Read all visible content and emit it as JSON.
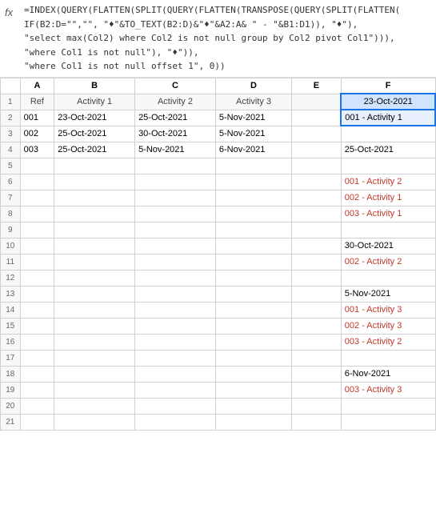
{
  "formula": {
    "fx_label": "fx",
    "text_lines": [
      "=INDEX(QUERY(FLATTEN(SPLIT(QUERY(FLATTEN(TRANSPOSE(QUERY(SPLIT(FLATTEN(",
      "IF(B2:D=\"\",\"\", \"♦\"&TO_TEXT(B2:D)&\"♦\"&A2:A& \" - \"&B1:D1)), \"♦\"),",
      "\"select max(Col2) where Col2 is not null group by Col2 pivot Col1\"))),",
      "\"where Col1 is not null\"), \"♦\")),",
      "\"where Col1 is not null offset 1\", 0))"
    ]
  },
  "columns": {
    "headers": [
      "",
      "A",
      "B",
      "C",
      "D",
      "E",
      "F"
    ]
  },
  "column_labels": {
    "A": "Ref",
    "B": "Activity 1",
    "C": "Activity 2",
    "D": "Activity 3",
    "E": "",
    "F": "23-Oct-2021"
  },
  "rows": [
    {
      "num": "1",
      "A": "Ref",
      "B": "Activity 1",
      "C": "Activity 2",
      "D": "Activity 3",
      "E": "",
      "F": "23-Oct-2021",
      "F_color": "normal"
    },
    {
      "num": "2",
      "A": "001",
      "B": "23-Oct-2021",
      "C": "25-Oct-2021",
      "D": "5-Nov-2021",
      "E": "",
      "F": "001 - Activity 1",
      "F_color": "normal"
    },
    {
      "num": "3",
      "A": "002",
      "B": "25-Oct-2021",
      "C": "30-Oct-2021",
      "D": "5-Nov-2021",
      "E": "",
      "F": "",
      "F_color": "normal"
    },
    {
      "num": "4",
      "A": "003",
      "B": "25-Oct-2021",
      "C": "5-Nov-2021",
      "D": "6-Nov-2021",
      "E": "",
      "F": "25-Oct-2021",
      "F_color": "normal"
    },
    {
      "num": "5",
      "A": "",
      "B": "",
      "C": "",
      "D": "",
      "E": "",
      "F": "",
      "F_color": "normal"
    },
    {
      "num": "6",
      "A": "",
      "B": "",
      "C": "",
      "D": "",
      "E": "",
      "F": "001 - Activity 2",
      "F_color": "pink"
    },
    {
      "num": "7",
      "A": "",
      "B": "",
      "C": "",
      "D": "",
      "E": "",
      "F": "002 - Activity 1",
      "F_color": "pink"
    },
    {
      "num": "8",
      "A": "",
      "B": "",
      "C": "",
      "D": "",
      "E": "",
      "F": "003 - Activity 1",
      "F_color": "pink"
    },
    {
      "num": "9",
      "A": "",
      "B": "",
      "C": "",
      "D": "",
      "E": "",
      "F": "",
      "F_color": "normal"
    },
    {
      "num": "10",
      "A": "",
      "B": "",
      "C": "",
      "D": "",
      "E": "",
      "F": "30-Oct-2021",
      "F_color": "normal"
    },
    {
      "num": "11",
      "A": "",
      "B": "",
      "C": "",
      "D": "",
      "E": "",
      "F": "002 - Activity 2",
      "F_color": "pink"
    },
    {
      "num": "12",
      "A": "",
      "B": "",
      "C": "",
      "D": "",
      "E": "",
      "F": "",
      "F_color": "normal"
    },
    {
      "num": "13",
      "A": "",
      "B": "",
      "C": "",
      "D": "",
      "E": "",
      "F": "5-Nov-2021",
      "F_color": "normal"
    },
    {
      "num": "14",
      "A": "",
      "B": "",
      "C": "",
      "D": "",
      "E": "",
      "F": "001 - Activity 3",
      "F_color": "pink"
    },
    {
      "num": "15",
      "A": "",
      "B": "",
      "C": "",
      "D": "",
      "E": "",
      "F": "002 - Activity 3",
      "F_color": "pink"
    },
    {
      "num": "16",
      "A": "",
      "B": "",
      "C": "",
      "D": "",
      "E": "",
      "F": "003 - Activity 2",
      "F_color": "pink"
    },
    {
      "num": "17",
      "A": "",
      "B": "",
      "C": "",
      "D": "",
      "E": "",
      "F": "",
      "F_color": "normal"
    },
    {
      "num": "18",
      "A": "",
      "B": "",
      "C": "",
      "D": "",
      "E": "",
      "F": "6-Nov-2021",
      "F_color": "normal"
    },
    {
      "num": "19",
      "A": "",
      "B": "",
      "C": "",
      "D": "",
      "E": "",
      "F": "003 - Activity 3",
      "F_color": "pink"
    },
    {
      "num": "20",
      "A": "",
      "B": "",
      "C": "",
      "D": "",
      "E": "",
      "F": "",
      "F_color": "normal"
    },
    {
      "num": "21",
      "A": "",
      "B": "",
      "C": "",
      "D": "",
      "E": "",
      "F": "",
      "F_color": "normal"
    }
  ]
}
